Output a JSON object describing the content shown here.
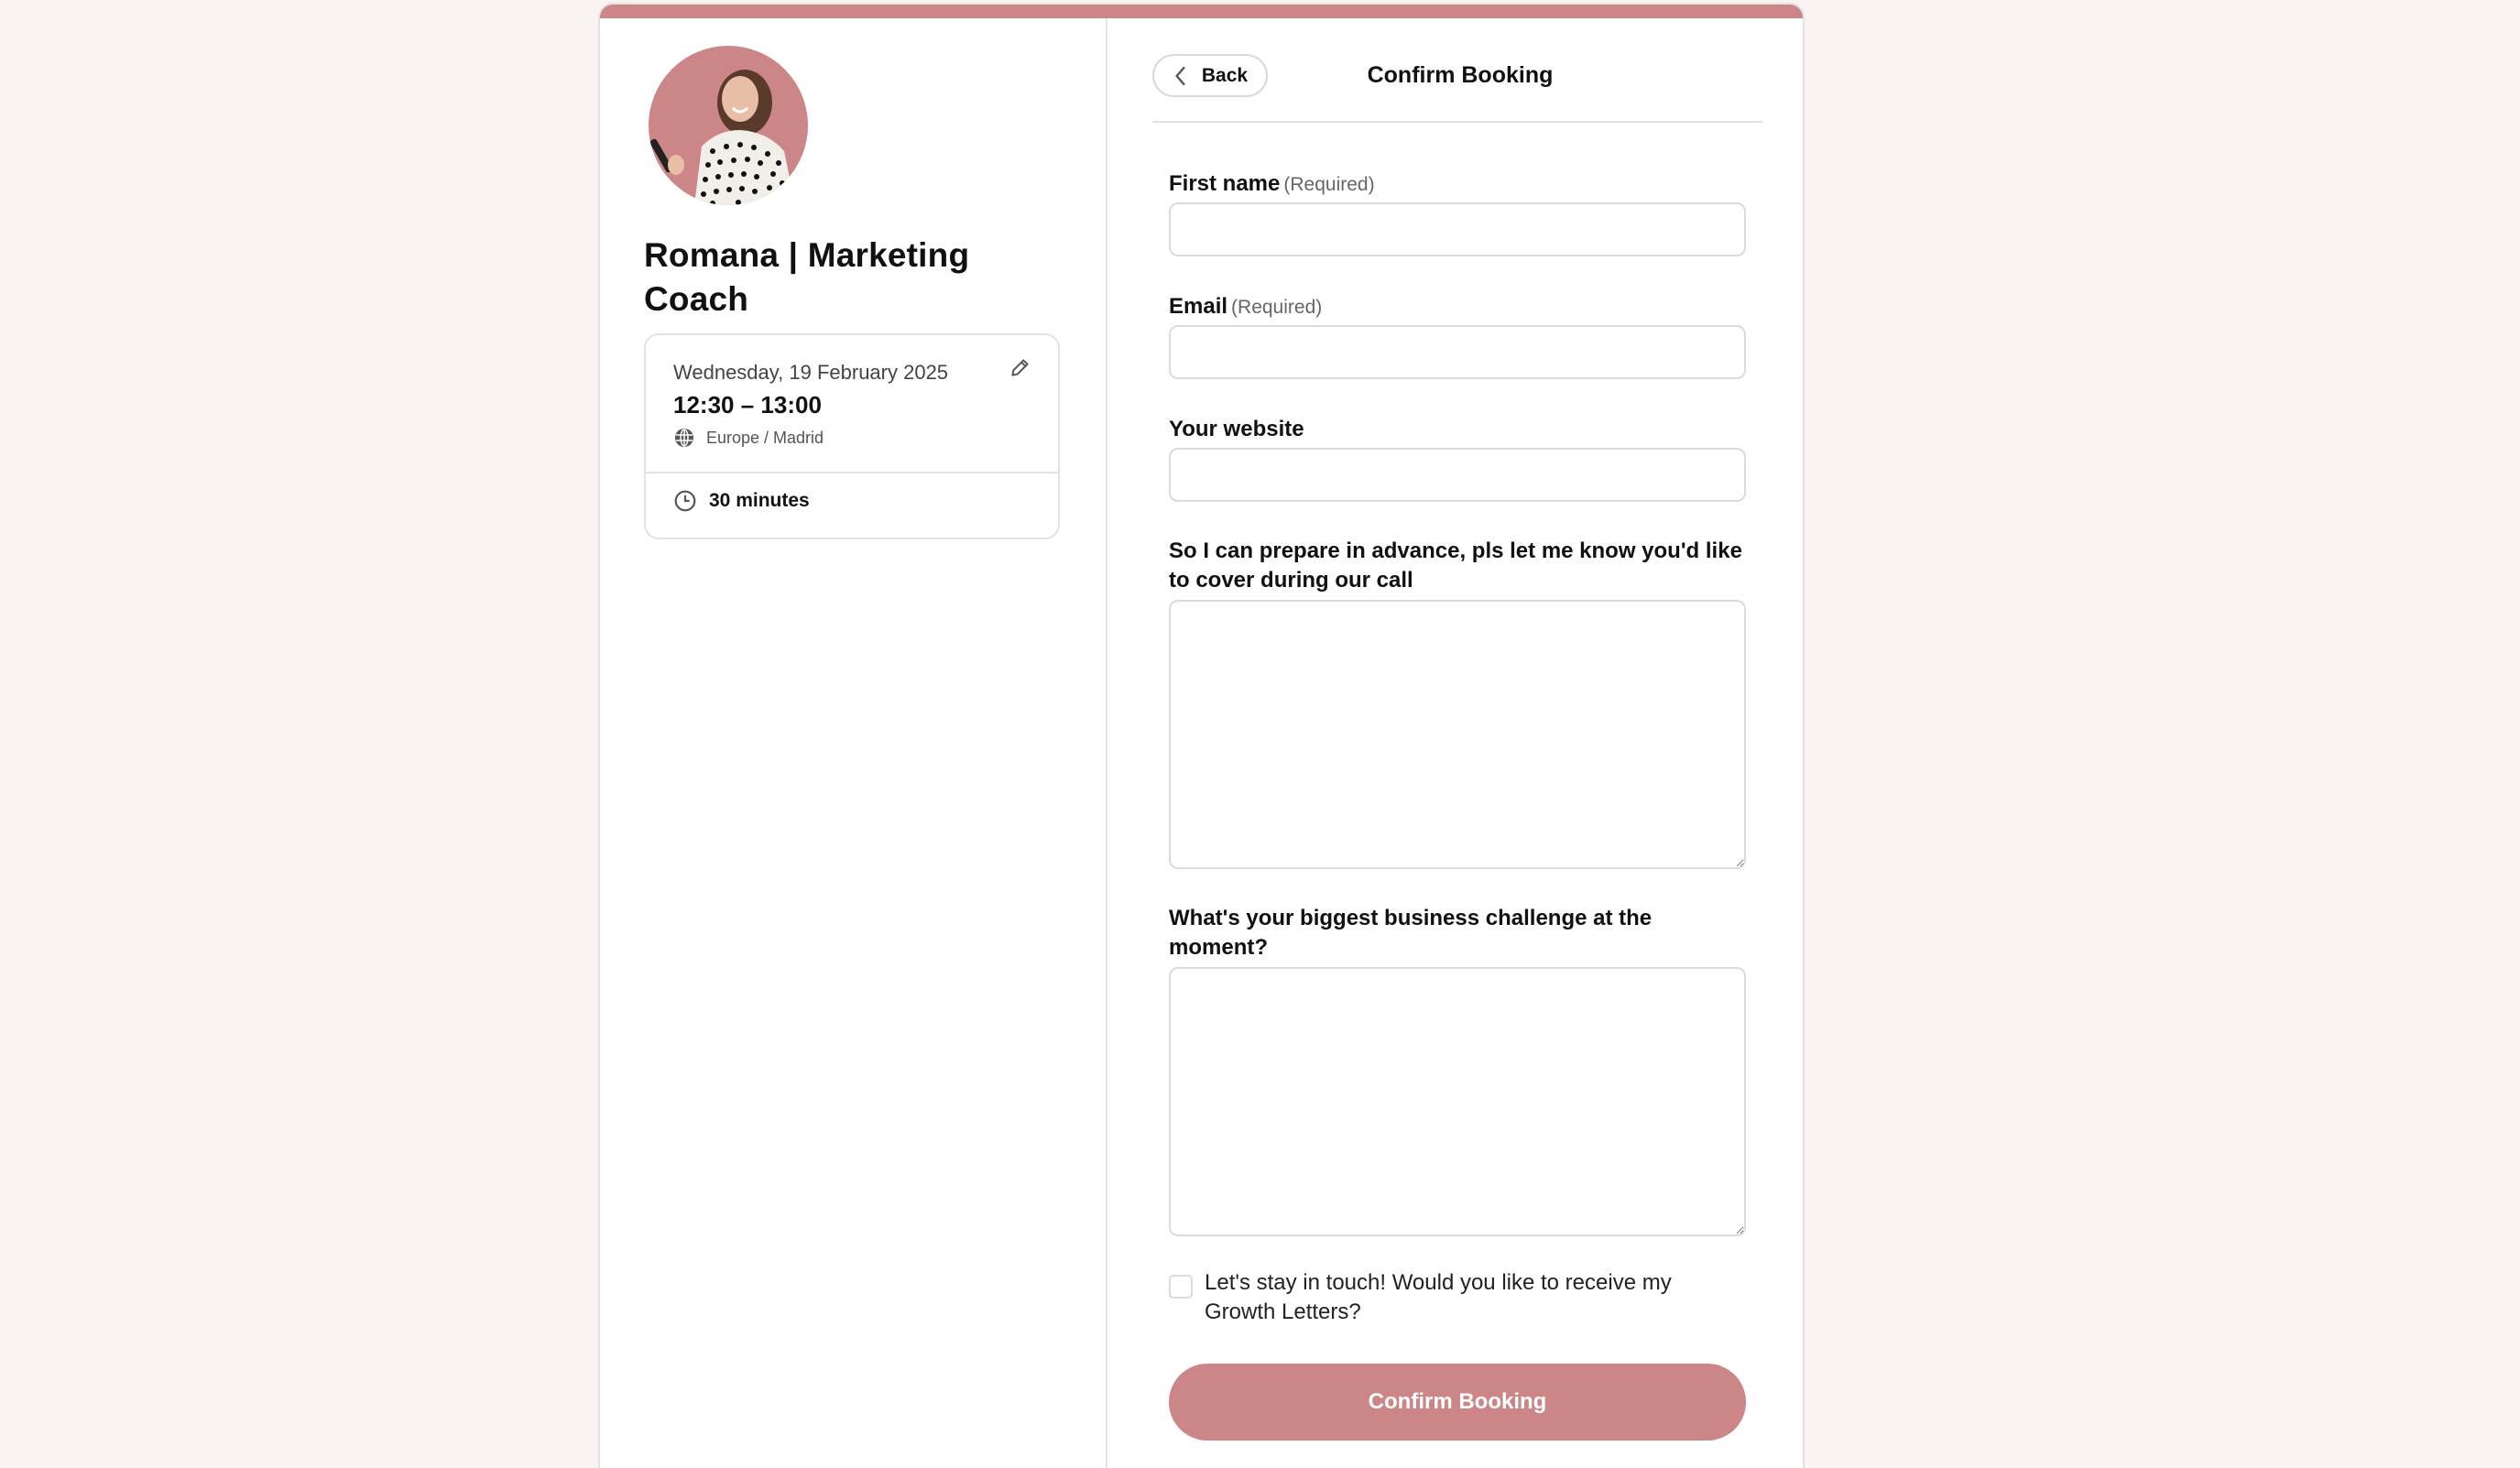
{
  "theme": {
    "accent": "#cd8688",
    "background": "#faf3f3"
  },
  "profile": {
    "name": "Romana | Marketing Coach",
    "avatar_alt": "Profile photo of Romana"
  },
  "event": {
    "date": "Wednesday, 19 February 2025",
    "time_range": "12:30 – 13:00",
    "timezone": "Europe / Madrid",
    "duration": "30 minutes",
    "icons": {
      "edit": "pencil-icon",
      "timezone": "globe-icon",
      "duration": "clock-icon"
    }
  },
  "header": {
    "back_label": "Back",
    "title": "Confirm Booking"
  },
  "form": {
    "required_suffix": "(Required)",
    "fields": [
      {
        "label": "First name",
        "required": true,
        "type": "text",
        "value": ""
      },
      {
        "label": "Email",
        "required": true,
        "type": "email",
        "value": ""
      },
      {
        "label": "Your website",
        "required": false,
        "type": "text",
        "value": ""
      },
      {
        "label": "So I can prepare in advance, pls let me know you'd like to cover during our call",
        "required": false,
        "type": "textarea",
        "value": ""
      },
      {
        "label": "What's your biggest business challenge at the moment?",
        "required": false,
        "type": "textarea",
        "value": ""
      }
    ],
    "newsletter": {
      "label": "Let's stay in touch! Would you like to receive my Growth Letters?",
      "checked": false
    },
    "submit_label": "Confirm Booking"
  }
}
